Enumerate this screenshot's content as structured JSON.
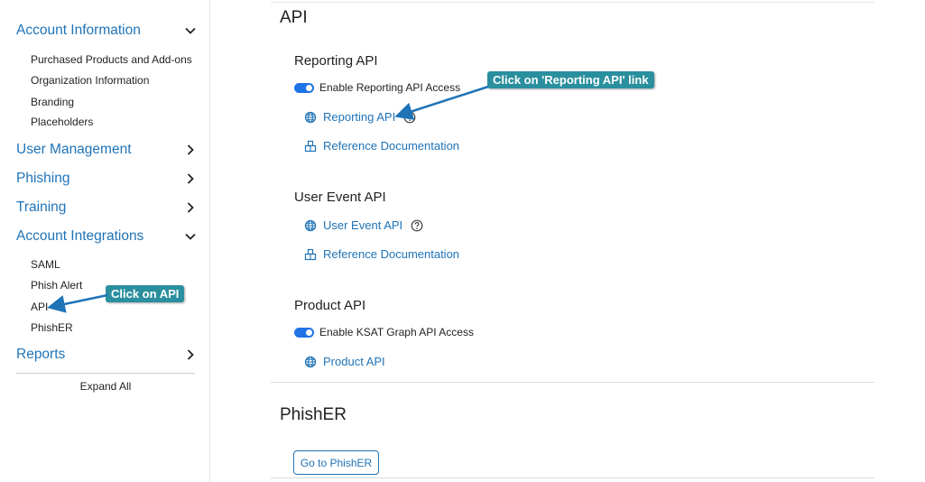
{
  "sidebar": {
    "sections": [
      {
        "label": "Account Information",
        "expanded": true,
        "icon": "chevron-down-icon"
      },
      {
        "label": "User Management",
        "expanded": false,
        "icon": "chevron-right-icon"
      },
      {
        "label": "Phishing",
        "expanded": false,
        "icon": "chevron-right-icon"
      },
      {
        "label": "Training",
        "expanded": false,
        "icon": "chevron-right-icon"
      },
      {
        "label": "Account Integrations",
        "expanded": true,
        "icon": "chevron-down-icon"
      },
      {
        "label": "Reports",
        "expanded": false,
        "icon": "chevron-right-icon"
      }
    ],
    "account_information_items": [
      "Purchased Products and Add-ons",
      "Organization Information",
      "Branding",
      "Placeholders"
    ],
    "account_integrations_items": [
      "SAML",
      "Phish Alert",
      "API",
      "PhishER"
    ],
    "expand_all": "Expand All"
  },
  "main": {
    "title": "API",
    "reporting": {
      "heading": "Reporting API",
      "toggle_label": "Enable Reporting API Access",
      "toggle_on": true,
      "link": "Reporting API",
      "docs": "Reference Documentation"
    },
    "user_event": {
      "heading": "User Event API",
      "link": "User Event API",
      "docs": "Reference Documentation"
    },
    "product": {
      "heading": "Product API",
      "toggle_label": "Enable KSAT Graph API Access",
      "toggle_on": true,
      "link": "Product API"
    },
    "phisher": {
      "heading": "PhishER",
      "button": "Go to PhishER"
    }
  },
  "annotations": {
    "reporting_callout": "Click on 'Reporting API' link",
    "api_callout": "Click on API"
  },
  "colors": {
    "link": "#1f73b7",
    "toggle": "#1f73e6",
    "callout": "#2a8f9e"
  }
}
